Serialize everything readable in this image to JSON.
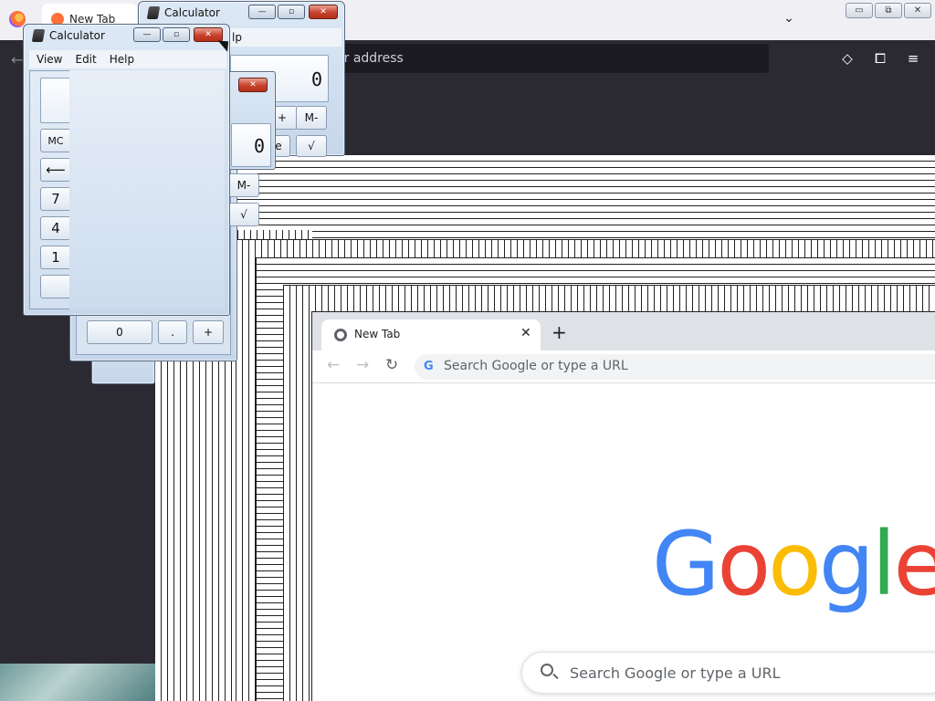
{
  "firefox": {
    "tab_title": "New Tab",
    "urlbar_placeholder": "Search or enter address",
    "urlbar_visible_fragment": "er address",
    "caption": {
      "minimize": "▭",
      "restore": "⧉",
      "close": "✕"
    },
    "list_all_tabs": "⌄",
    "toolbar_icons": [
      "pocket-icon",
      "extensions-icon",
      "menu-icon"
    ],
    "toolbar_glyphs": {
      "pocket": "◇",
      "extensions": "⧠",
      "menu": "≡"
    },
    "back_glyph": "←"
  },
  "calculators": {
    "title": "Calculator",
    "menu": {
      "view": "View",
      "edit": "Edit",
      "help": "Help"
    },
    "menu_help_fragment": "lp",
    "display_value": "0",
    "keys": {
      "mc": "MC",
      "mminus": "M-",
      "plus": "+",
      "sqrt": "√",
      "backspace": "⟵",
      "seven": "7",
      "four": "4",
      "one": "1",
      "zero": "0",
      "dot": ".",
      "e_fragment": "e"
    },
    "caption": {
      "minimize": "—",
      "maximize": "▫",
      "close": "✕"
    }
  },
  "chrome": {
    "tab_title": "New Tab",
    "tab_close": "✕",
    "new_tab": "+",
    "back": "←",
    "forward": "→",
    "reload": "↻",
    "omnibox_placeholder": "Search Google or type a URL",
    "g_icon": "G",
    "logo": {
      "letters": [
        "G",
        "o",
        "o",
        "g",
        "l",
        "e"
      ],
      "colors": [
        "#4285f4",
        "#ea4335",
        "#fbbc05",
        "#4285f4",
        "#34a853",
        "#ea4335"
      ]
    },
    "search_placeholder": "Search Google or type a URL"
  }
}
